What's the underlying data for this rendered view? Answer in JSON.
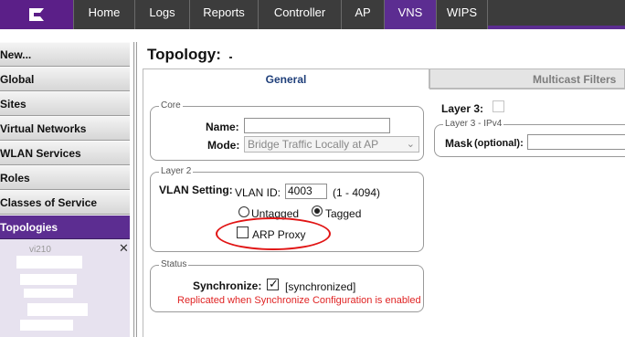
{
  "nav": {
    "logo_icon": "extreme-logo-icon",
    "tabs": [
      {
        "label": "Home"
      },
      {
        "label": "Logs"
      },
      {
        "label": "Reports"
      },
      {
        "label": "Controller"
      },
      {
        "label": "AP"
      },
      {
        "label": "VNS"
      },
      {
        "label": "WIPS"
      }
    ],
    "active_tab": "VNS",
    "active_color": "#5c2d91"
  },
  "sidebar": {
    "items": [
      {
        "label": "New..."
      },
      {
        "label": "Global"
      },
      {
        "label": "Sites"
      },
      {
        "label": "Virtual Networks"
      },
      {
        "label": "WLAN Services"
      },
      {
        "label": "Roles"
      },
      {
        "label": "Classes of Service"
      },
      {
        "label": "Topologies"
      }
    ],
    "active_item": "Topologies",
    "sub_item_partial": "vi210"
  },
  "page": {
    "title": "Topology:",
    "tabs": [
      {
        "label": "General"
      },
      {
        "label": "Multicast Filters"
      }
    ],
    "active_tab": "General"
  },
  "core": {
    "legend": "Core",
    "name_label": "Name:",
    "name_value": "",
    "mode_label": "Mode:",
    "mode_value": "Bridge Traffic Locally at AP"
  },
  "layer2": {
    "legend": "Layer 2",
    "vlan_setting_label": "VLAN Setting:",
    "vlan_id_label": "VLAN ID:",
    "vlan_id_value": "4003",
    "vlan_range": "(1 - 4094)",
    "untagged_label": "Untagged",
    "tagged_label": "Tagged",
    "selected": "Tagged",
    "arp_proxy_label": "ARP Proxy",
    "arp_proxy_checked": false,
    "highlight_color": "#e11414"
  },
  "status": {
    "legend": "Status",
    "synchronize_label": "Synchronize:",
    "synchronize_checked": true,
    "synchronize_state": "[synchronized]",
    "note": "Replicated when Synchronize Configuration is enabled",
    "note_color": "#e02424"
  },
  "layer3": {
    "label": "Layer 3:",
    "checked": false,
    "ipv4_legend": "Layer 3 - IPv4",
    "mask_label": "Mask",
    "mask_optional": "(optional):",
    "mask_value": ""
  }
}
